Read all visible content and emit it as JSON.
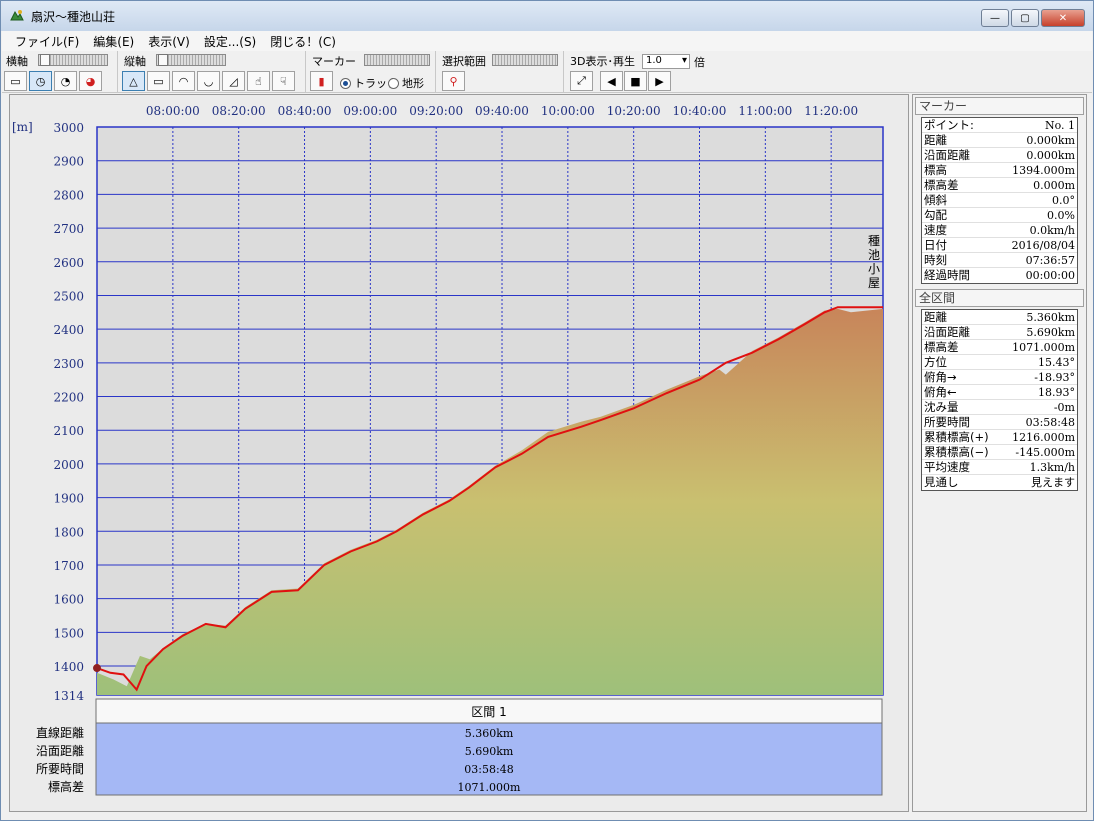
{
  "window": {
    "title": "扇沢～種池山荘",
    "buttons": {
      "minimize": "—",
      "maximize": "▢",
      "close": "✕"
    }
  },
  "menu": [
    {
      "label": "ファイル(F)"
    },
    {
      "label": "編集(E)"
    },
    {
      "label": "表示(V)"
    },
    {
      "label": "設定...(S)"
    },
    {
      "label": "閉じる！(C)"
    }
  ],
  "toolbar": {
    "horizontal_label": "横軸",
    "vertical_label": "縦軸",
    "marker_label": "マーカー",
    "marker_options": [
      "トラック",
      "地形"
    ],
    "marker_selected": "トラック",
    "range_label": "選択範囲",
    "view3d_label": "3D表示･再生",
    "speed_value": "1.0",
    "speed_unit": "倍"
  },
  "chart_data": {
    "type": "area",
    "y_unit_label": "[m]",
    "ylim": [
      1314,
      3000
    ],
    "y_ticks": [
      "3000",
      "2900",
      "2800",
      "2700",
      "2600",
      "2500",
      "2400",
      "2300",
      "2200",
      "2100",
      "2000",
      "1900",
      "1800",
      "1700",
      "1600",
      "1500",
      "1400",
      "1314"
    ],
    "x_ticks": [
      "08:00:00",
      "08:20:00",
      "08:40:00",
      "09:00:00",
      "09:20:00",
      "09:40:00",
      "10:00:00",
      "10:20:00",
      "10:40:00",
      "11:00:00",
      "11:20:00"
    ],
    "x_start": "07:36:57",
    "x_end": "11:35:45",
    "track": {
      "x": [
        "07:36:57",
        "07:41:00",
        "07:45:00",
        "07:49:00",
        "07:52:00",
        "07:57:00",
        "08:03:00",
        "08:10:00",
        "08:16:00",
        "08:22:00",
        "08:30:00",
        "08:38:00",
        "08:46:00",
        "08:54:00",
        "09:02:00",
        "09:08:00",
        "09:16:00",
        "09:24:00",
        "09:30:00",
        "09:38:00",
        "09:46:00",
        "09:54:00",
        "10:04:00",
        "10:10:00",
        "10:20:00",
        "10:30:00",
        "10:40:00",
        "10:48:00",
        "10:56:00",
        "11:04:00",
        "11:12:00",
        "11:18:00",
        "11:22:00",
        "11:35:45"
      ],
      "elev": [
        1394,
        1380,
        1375,
        1330,
        1400,
        1450,
        1490,
        1525,
        1515,
        1570,
        1620,
        1625,
        1700,
        1740,
        1770,
        1800,
        1850,
        1890,
        1930,
        1990,
        2030,
        2080,
        2110,
        2130,
        2165,
        2210,
        2250,
        2300,
        2330,
        2370,
        2415,
        2450,
        2465,
        2465
      ]
    },
    "terrain": {
      "x": [
        "07:36:57",
        "07:42:00",
        "07:46:00",
        "07:50:00",
        "07:53:00",
        "07:58:00",
        "08:03:00",
        "08:10:00",
        "08:16:00",
        "08:22:00",
        "08:30:00",
        "08:38:00",
        "08:46:00",
        "08:54:00",
        "09:02:00",
        "09:08:00",
        "09:16:00",
        "09:24:00",
        "09:30:00",
        "09:38:00",
        "09:46:00",
        "09:54:00",
        "10:04:00",
        "10:10:00",
        "10:20:00",
        "10:30:00",
        "10:40:00",
        "10:46:00",
        "10:48:00",
        "10:56:00",
        "11:04:00",
        "11:12:00",
        "11:18:00",
        "11:22:00",
        "11:26:00",
        "11:35:45"
      ],
      "elev": [
        1380,
        1360,
        1340,
        1430,
        1420,
        1460,
        1495,
        1525,
        1520,
        1575,
        1625,
        1630,
        1705,
        1745,
        1775,
        1805,
        1855,
        1895,
        1935,
        1995,
        2040,
        2095,
        2125,
        2140,
        2175,
        2220,
        2260,
        2280,
        2265,
        2335,
        2375,
        2420,
        2455,
        2460,
        2450,
        2460
      ]
    },
    "annotation": "種池小屋",
    "annotation_x": "11:33:00",
    "grid": true
  },
  "summary": {
    "header": "区間 1",
    "rows": [
      {
        "label": "直線距離",
        "value": "5.360km"
      },
      {
        "label": "沿面距離",
        "value": "5.690km"
      },
      {
        "label": "所要時間",
        "value": "03:58:48"
      },
      {
        "label": "標高差",
        "value": "1071.000m"
      }
    ]
  },
  "marker_panel": {
    "title": "マーカー",
    "rows": [
      {
        "label": "ポイント:",
        "value": "No. 1"
      },
      {
        "label": "距離",
        "value": "0.000km"
      },
      {
        "label": "沿面距離",
        "value": "0.000km"
      },
      {
        "label": "標高",
        "value": "1394.000m"
      },
      {
        "label": "標高差",
        "value": "0.000m"
      },
      {
        "label": "傾斜",
        "value": "0.0°"
      },
      {
        "label": "勾配",
        "value": "0.0%"
      },
      {
        "label": "速度",
        "value": "0.0km/h"
      },
      {
        "label": "日付",
        "value": "2016/08/04"
      },
      {
        "label": "時刻",
        "value": "07:36:57"
      },
      {
        "label": "経過時間",
        "value": "00:00:00"
      }
    ]
  },
  "total_panel": {
    "title": "全区間",
    "rows": [
      {
        "label": "距離",
        "value": "5.360km"
      },
      {
        "label": "沿面距離",
        "value": "5.690km"
      },
      {
        "label": "標高差",
        "value": "1071.000m"
      },
      {
        "label": "方位",
        "value": "15.43°"
      },
      {
        "label": "俯角→",
        "value": "-18.93°"
      },
      {
        "label": "俯角←",
        "value": "18.93°"
      },
      {
        "label": "沈み量",
        "value": "-0m"
      },
      {
        "label": "所要時間",
        "value": "03:58:48"
      },
      {
        "label": "累積標高(+)",
        "value": "1216.000m"
      },
      {
        "label": "累積標高(−)",
        "value": "-145.000m"
      },
      {
        "label": "平均速度",
        "value": "1.3km/h"
      },
      {
        "label": "見通し",
        "value": "見えます"
      }
    ]
  },
  "colors": {
    "track": "#e01010",
    "grid": "#2a35c8",
    "plot_bg": "#dcdcdc",
    "terrain_top": "#c8855a",
    "terrain_mid": "#c9c070",
    "terrain_bottom": "#9ec07a",
    "summary_bg": "#a5b8f5"
  }
}
